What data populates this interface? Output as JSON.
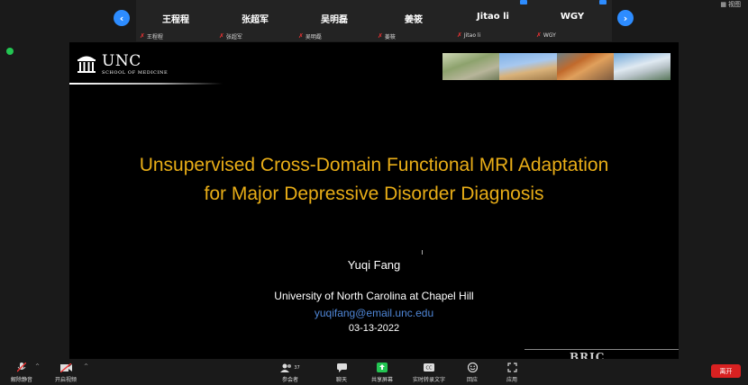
{
  "meeting": {
    "participants": [
      {
        "name": "王程程",
        "label": "王程程"
      },
      {
        "name": "张超军",
        "label": "张超军"
      },
      {
        "name": "吴明磊",
        "label": "吴明磊"
      },
      {
        "name": "姜筱",
        "label": "姜筱"
      },
      {
        "name": "Jitao li",
        "label": "Jitao li"
      },
      {
        "name": "WGY",
        "label": "WGY"
      }
    ],
    "view_label": "视图",
    "prev_glyph": "‹",
    "next_glyph": "›"
  },
  "slide": {
    "org_name": "UNC",
    "org_sub": "SCHOOL OF MEDICINE",
    "title_line1": "Unsupervised Cross-Domain Functional MRI Adaptation",
    "title_line2": "for Major Depressive Disorder Diagnosis",
    "author": "Yuqi Fang",
    "affiliation": "University of North Carolina at Chapel Hill",
    "email": "yuqifang@email.unc.edu",
    "date": "03-13-2022",
    "bottom_logo": "BRIC",
    "title_color": "#e8ad17",
    "email_color": "#4f86d6"
  },
  "toolbar": {
    "mute_label": "解除静音",
    "video_label": "开启视频",
    "participants_label": "参会者",
    "participants_count": "37",
    "chat_label": "聊天",
    "share_label": "共享屏幕",
    "caption_label": "实时转录文字",
    "reaction_label": "回应",
    "apps_label": "应用",
    "leave_label": "离开",
    "accent_color": "#23c552",
    "leave_color": "#d92121"
  }
}
